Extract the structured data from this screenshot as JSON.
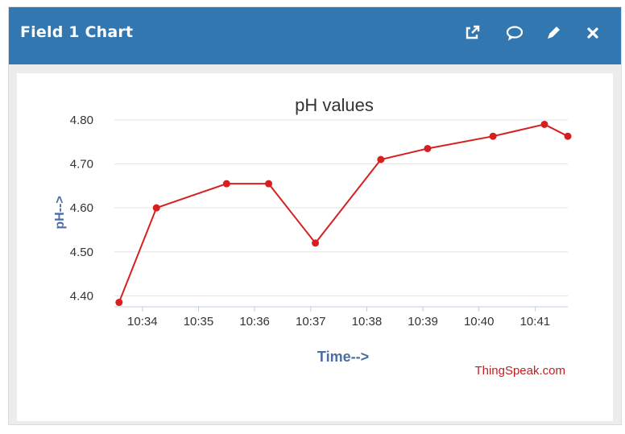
{
  "header": {
    "title": "Field 1 Chart",
    "icons": [
      "external-link-icon",
      "comment-icon",
      "pencil-icon",
      "close-icon"
    ]
  },
  "colors": {
    "header_bg": "#3377b1",
    "series": "#d62020",
    "axis_label": "#4a6da3",
    "credit": "#c41e1e"
  },
  "chart_data": {
    "type": "line",
    "title": "pH values",
    "xlabel": "Time-->",
    "ylabel": "pH-->",
    "credit": "ThingSpeak.com",
    "ylim": [
      4.375,
      4.8
    ],
    "yticks": [
      "4.40",
      "4.50",
      "4.60",
      "4.70",
      "4.80"
    ],
    "ytick_values": [
      4.4,
      4.5,
      4.6,
      4.7,
      4.8
    ],
    "xlim": [
      "10:33:30",
      "10:41:35"
    ],
    "xticks": [
      "10:34",
      "10:35",
      "10:36",
      "10:37",
      "10:38",
      "10:39",
      "10:40",
      "10:41"
    ],
    "grid": true,
    "series": [
      {
        "x": [
          "10:33:35",
          "10:34:15",
          "10:35:30",
          "10:36:15",
          "10:37:05",
          "10:38:15",
          "10:39:05",
          "10:40:15",
          "10:41:10",
          "10:41:35"
        ],
        "y": [
          4.385,
          4.6,
          4.655,
          4.655,
          4.52,
          4.71,
          4.735,
          4.763,
          4.79,
          4.763
        ]
      }
    ]
  }
}
